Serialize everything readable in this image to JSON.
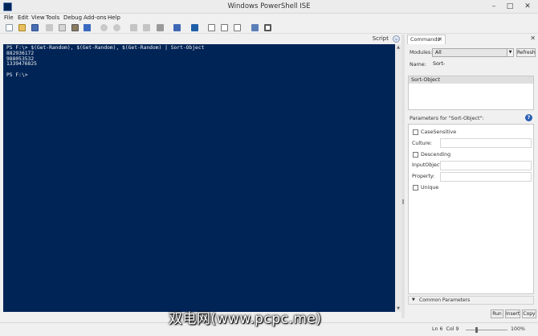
{
  "window": {
    "title": "Windows PowerShell ISE",
    "controls": {
      "minimize": "–",
      "maximize": "□",
      "close": "✕"
    }
  },
  "menu": [
    "File",
    "Edit",
    "View",
    "Tools",
    "Debug",
    "Add-ons",
    "Help"
  ],
  "toolbar": {
    "icons": [
      "new-file-icon",
      "open-folder-icon",
      "save-icon",
      "cut-icon",
      "copy-icon",
      "paste-icon",
      "clear-console-icon",
      "undo-icon",
      "redo-icon",
      "run-script-icon",
      "run-selection-icon",
      "stop-icon",
      "new-remote-tab-icon",
      "start-powershell-icon",
      "show-script-top-icon",
      "show-script-right-icon",
      "show-script-max-icon",
      "show-command-addon-icon",
      "show-script-pane-icon"
    ]
  },
  "script_pane": {
    "label": "Script",
    "toggle_glyph": "⌄"
  },
  "console": {
    "lines": [
      "PS F:\\> $(Get-Random), $(Get-Random), $(Get-Random) | Sort-Object",
      "882936172",
      "988053532",
      "1339476825",
      "",
      "PS F:\\>"
    ],
    "colors": {
      "background": "#012456",
      "foreground": "#f2f2f2"
    }
  },
  "commands_panel": {
    "tab_label": "Commands",
    "tab_close": "✕",
    "panel_close": "✕",
    "modules_label": "Modules:",
    "modules_value": "All",
    "refresh_label": "Refresh",
    "name_label": "Name:",
    "name_value": "Sort-",
    "results": [
      "Sort-Object"
    ],
    "parameters_header": "Parameters for \"Sort-Object\":",
    "help_glyph": "?",
    "parameters": {
      "case_sensitive": "CaseSensitive",
      "culture": "Culture:",
      "descending": "Descending",
      "input_object": "InputObject:",
      "property": "Property:",
      "unique": "Unique"
    },
    "common_parameters": "Common Parameters",
    "buttons": {
      "run": "Run",
      "insert": "Insert",
      "copy": "Copy"
    }
  },
  "status_bar": {
    "line_label": "Ln 6",
    "col_label": "Col 9",
    "zoom": "100%",
    "zoom_level": 0.25
  },
  "watermark": "双电网(www.pcpc.me)"
}
